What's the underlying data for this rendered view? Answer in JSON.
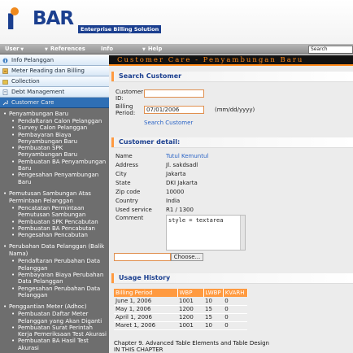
{
  "brand": {
    "logo_text": "iBAR",
    "logo_word": "BAR",
    "tagline": "Enterprise Billing Solution"
  },
  "menu": [
    {
      "label": "User"
    },
    {
      "label": "References"
    },
    {
      "label": "Info"
    },
    {
      "label": "Help"
    }
  ],
  "search": {
    "value": "Search"
  },
  "sidebar": {
    "items": [
      {
        "label": "Info Pelanggan"
      },
      {
        "label": "Meter Reading dan Billing"
      },
      {
        "label": "Collection"
      },
      {
        "label": "Debt Management"
      },
      {
        "label": "Customer Care"
      }
    ],
    "groups": [
      {
        "title": "Penyambungan Baru",
        "items": [
          "Pendaftaran Calon Pelanggan",
          "Survey Calon Pelanggan",
          "Pembayaran Biaya Penyambungan Baru",
          "Pembuatan SPK Penyambungan Baru",
          "Pembuatan BA Penyambungan Baru",
          "Pengesahan Penyambungan Baru"
        ]
      },
      {
        "title": "Pemutusan Sambungan Atas Permintaan Pelanggan",
        "items": [
          "Pencatatan Permintaan Pemutusan Sambungan",
          "Pembuatan SPK Pencabutan",
          "Pembuatan BA Pencabutan",
          "Pengesahan Pencabutan"
        ]
      },
      {
        "title": "Perubahan Data Pelanggan (Balik Nama)",
        "items": [
          "Pendaftaran Perubahan Data Pelanggan",
          "Pembayaran Biaya Perubahan Data Pelanggan",
          "Pengesahan Perubahan Data Pelanggan"
        ]
      },
      {
        "title": "Penggantian Meter (Adhoc)",
        "items": [
          "Pembuatan Daftar Meter Pelanggan yang Akan Diganti",
          "Pembuatan Surat Perintah Kerja Pemeriksaan Test Akurasi",
          "Pembuatan BA Hasil Test Akurasi"
        ]
      }
    ]
  },
  "page": {
    "title": "Customer Care - Penyambungan Baru"
  },
  "search_customer": {
    "heading": "Search Customer",
    "customer_id_label": "Customer ID:",
    "customer_id_value": "",
    "billing_period_label": "Billing Period:",
    "billing_period_value": "07/01/2006",
    "date_hint": "(mm/dd/yyyy)",
    "search_link": "Search Customer"
  },
  "customer_detail": {
    "heading": "Customer detail:",
    "fields": [
      {
        "label": "Name",
        "value": "Tutul Kemuntul",
        "is_link": true
      },
      {
        "label": "Address",
        "value": "Jl. sakdsadl"
      },
      {
        "label": "City",
        "value": "Jakarta"
      },
      {
        "label": "State",
        "value": "DKI Jakarta"
      },
      {
        "label": "Zip code",
        "value": "10000"
      },
      {
        "label": "Country",
        "value": "India"
      },
      {
        "label": "Used service",
        "value": "R1 / 1300"
      }
    ],
    "comment_label": "Comment",
    "comment_value": "style = textarea",
    "choose_button": "Choose..."
  },
  "usage_history": {
    "heading": "Usage History",
    "columns": [
      "Billing Period",
      "WBP",
      "LWBP",
      "KVARH"
    ],
    "rows": [
      [
        "June 1, 2006",
        "1001",
        "10",
        "0"
      ],
      [
        "May 1, 2006",
        "1200",
        "15",
        "0"
      ],
      [
        "April 1, 2006",
        "1200",
        "15",
        "0"
      ],
      [
        "Maret 1, 2006",
        "1001",
        "10",
        "0"
      ]
    ]
  },
  "footer": {
    "line1": "Chapter 9. Advanced Table Elements and Table Design",
    "line2": "IN THIS CHAPTER"
  },
  "colors": {
    "accent": "#ff8a1a",
    "brand": "#1b3f8f",
    "sidebar_bg": "#6e6e6e",
    "link": "#2b64c6"
  }
}
